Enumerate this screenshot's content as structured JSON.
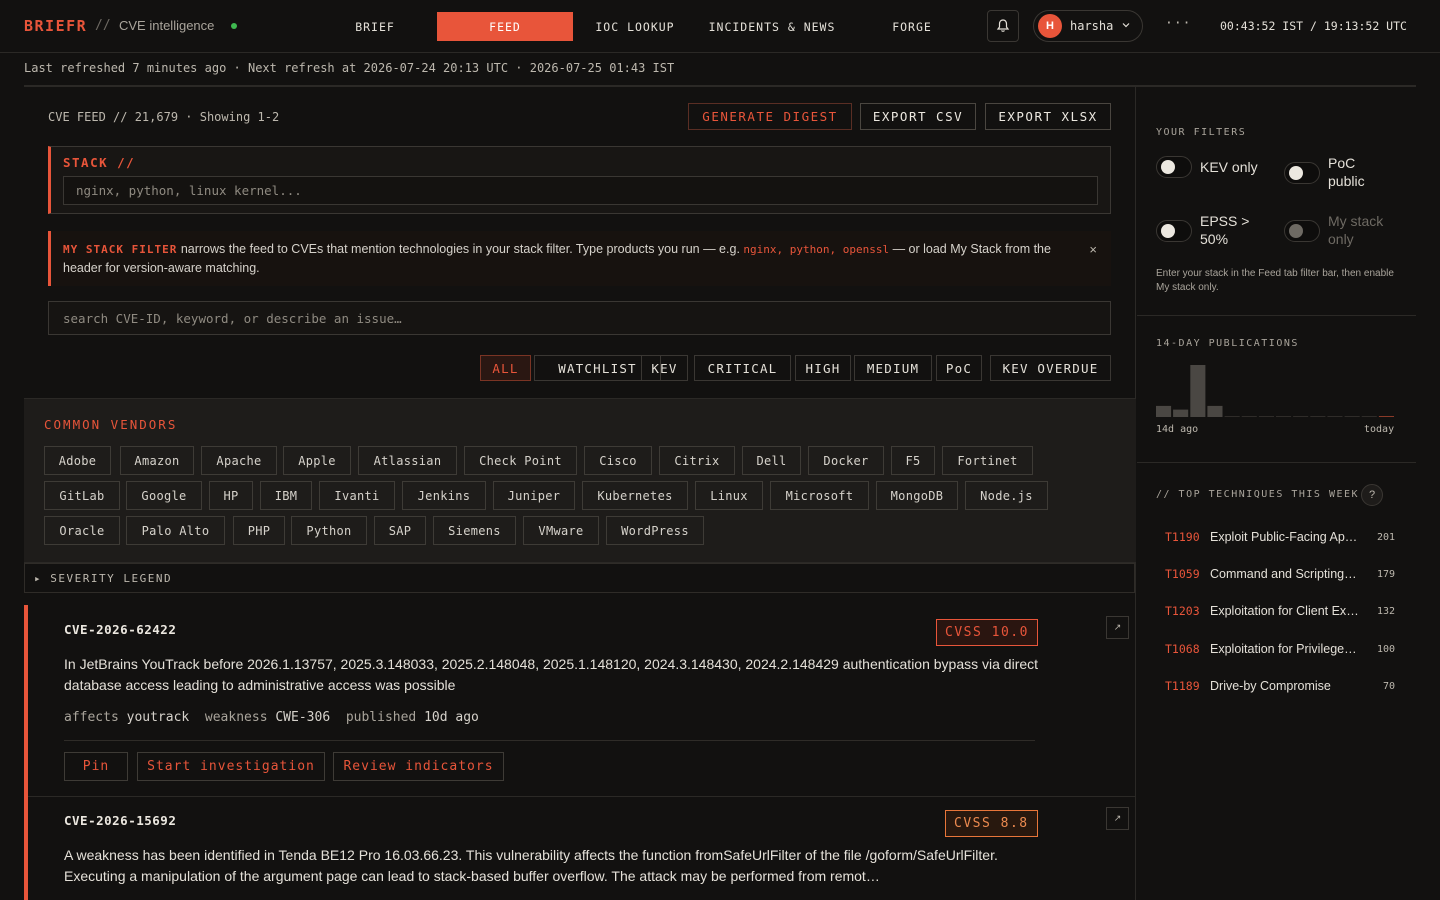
{
  "brand": {
    "name": "BRIEFR",
    "separator": "//",
    "subtitle": "CVE intelligence"
  },
  "nav": {
    "tabs": [
      "BRIEF",
      "FEED",
      "IOC LOOKUP",
      "INCIDENTS & NEWS",
      "FORGE"
    ],
    "active": "FEED"
  },
  "user": {
    "initial": "H",
    "name": "harsha"
  },
  "header": {
    "more": "···",
    "clock": "00:43:52 IST / 19:13:52 UTC"
  },
  "refresh": {
    "text": "Last refreshed 7 minutes ago · Next refresh at 2026-07-24 20:13 UTC · 2026-07-25 01:43 IST"
  },
  "feed": {
    "title": "CVE FEED // 21,679 · Showing 1-2",
    "buttons": {
      "digest": "GENERATE DIGEST",
      "csv": "EXPORT CSV",
      "xlsx": "EXPORT XLSX"
    },
    "stack": {
      "label": "STACK //",
      "placeholder": "nginx, python, linux kernel..."
    },
    "hint": {
      "strong": "MY STACK FILTER",
      "text_before": " narrows the feed to CVEs that mention technologies in your stack filter. Type products you run — e.g. ",
      "examples": "nginx, python, openssl",
      "text_after": " — or load My Stack from the header for version-aware matching.",
      "close": "×"
    },
    "search_placeholder": "search CVE-ID, keyword, or describe an issue…",
    "filters": [
      "ALL",
      "WATCHLIST",
      "KEV",
      "CRITICAL",
      "HIGH",
      "MEDIUM",
      "PoC",
      "KEV OVERDUE"
    ],
    "active_filter": "ALL"
  },
  "vendors": {
    "title": "COMMON VENDORS",
    "items": [
      "Adobe",
      "Amazon",
      "Apache",
      "Apple",
      "Atlassian",
      "Check Point",
      "Cisco",
      "Citrix",
      "Dell",
      "Docker",
      "F5",
      "Fortinet",
      "GitLab",
      "Google",
      "HP",
      "IBM",
      "Ivanti",
      "Jenkins",
      "Juniper",
      "Kubernetes",
      "Linux",
      "Microsoft",
      "MongoDB",
      "Node.js",
      "Oracle",
      "Palo Alto",
      "PHP",
      "Python",
      "SAP",
      "Siemens",
      "VMware",
      "WordPress"
    ]
  },
  "legend": {
    "label": "▸ SEVERITY LEGEND"
  },
  "cves": [
    {
      "id": "CVE-2026-62422",
      "cvss": "CVSS 10.0",
      "description": "In JetBrains YouTrack before 2026.1.13757, 2025.3.148033, 2025.2.148048, 2025.1.148120, 2024.3.148430, 2024.2.148429 authentication bypass via direct database access leading to administrative access was possible",
      "affects": "youtrack",
      "weakness": "CWE-306",
      "published": "10d ago",
      "actions": [
        "Pin",
        "Start investigation",
        "Review indicators"
      ]
    },
    {
      "id": "CVE-2026-15692",
      "cvss": "CVSS 8.8",
      "description": "A weakness has been identified in Tenda BE12 Pro 16.03.66.23. This vulnerability affects the function fromSafeUrlFilter of the file /goform/SafeUrlFilter. Executing a manipulation of the argument page can lead to stack-based buffer overflow. The attack may be performed from remot…"
    }
  ],
  "meta_labels": {
    "affects": "affects",
    "weakness": "weakness",
    "published": "published"
  },
  "expand_icon": "↗",
  "sidebar": {
    "filters_title": "YOUR FILTERS",
    "toggles": [
      {
        "label": "KEV only",
        "enabled": true
      },
      {
        "label": "PoC public",
        "enabled": true
      },
      {
        "label": "EPSS > 50%",
        "enabled": true
      },
      {
        "label": "My stack only",
        "enabled": false
      }
    ],
    "note": "Enter your stack in the Feed tab filter bar, then enable My stack only.",
    "pub_title": "14-DAY PUBLICATIONS",
    "publications": [
      3,
      2,
      14,
      3,
      0,
      0,
      0,
      0,
      0,
      0,
      0,
      0,
      0,
      0
    ],
    "pub_axis": {
      "left": "14d ago",
      "right": "today"
    },
    "tech_title": "// TOP TECHNIQUES THIS WEEK",
    "help": "?",
    "techniques": [
      {
        "id": "T1190",
        "name": "Exploit Public-Facing Application",
        "count": "201"
      },
      {
        "id": "T1059",
        "name": "Command and Scripting Interpreter",
        "count": "179"
      },
      {
        "id": "T1203",
        "name": "Exploitation for Client Execution",
        "count": "132"
      },
      {
        "id": "T1068",
        "name": "Exploitation for Privilege Escalation",
        "count": "100"
      },
      {
        "id": "T1189",
        "name": "Drive-by Compromise",
        "count": "70"
      }
    ]
  },
  "colors": {
    "accent": "#e8553a",
    "background": "#121110",
    "panel": "#1e1c1a"
  }
}
